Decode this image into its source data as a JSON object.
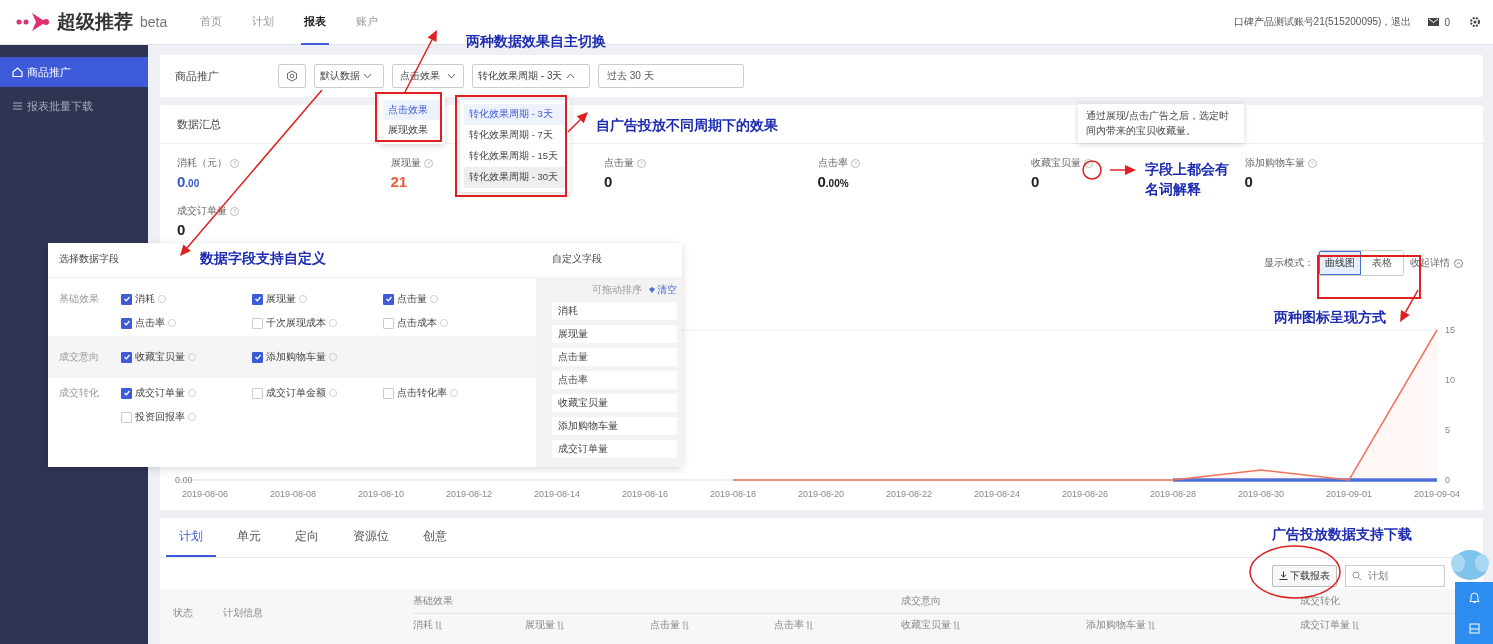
{
  "topbar": {
    "brand": "超级推荐",
    "badge": "beta",
    "nav": [
      {
        "label": "首页",
        "selected": false
      },
      {
        "label": "计划",
        "selected": false
      },
      {
        "label": "报表",
        "selected": true
      },
      {
        "label": "账户",
        "selected": false
      }
    ],
    "account": "口碑产品测试账号21(515200095)，退出",
    "messages": "0"
  },
  "sidebar": {
    "items": [
      {
        "label": "商品推广",
        "selected": true
      },
      {
        "label": "报表批量下载",
        "selected": false
      }
    ]
  },
  "filter_bar": {
    "title": "商品推广",
    "selects": [
      {
        "value": "默认数据",
        "expanded": false
      },
      {
        "value": "点击效果",
        "expanded": false
      },
      {
        "value": "转化效果周期 - 3天",
        "expanded": true
      }
    ],
    "date_range": "过去 30 天",
    "effect_menu": [
      {
        "label": "点击效果",
        "selected": true
      },
      {
        "label": "展现效果",
        "selected": false
      }
    ],
    "period_menu": [
      {
        "label": "转化效果周期 - 3天",
        "selected": true,
        "hovered": false
      },
      {
        "label": "转化效果周期 - 7天",
        "selected": false,
        "hovered": false
      },
      {
        "label": "转化效果周期 - 15天",
        "selected": false,
        "hovered": false
      },
      {
        "label": "转化效果周期 - 30天",
        "selected": false,
        "hovered": true
      }
    ]
  },
  "summary": {
    "title": "数据汇总",
    "metrics": [
      {
        "label": "消耗（元）",
        "value": "0",
        "suffix": ".00",
        "color": "#3557c9"
      },
      {
        "label": "展现量",
        "value": "21",
        "color": "#ee5a3a"
      },
      {
        "label": "点击量",
        "value": "0",
        "color": "#222222"
      },
      {
        "label": "点击率",
        "value": "0",
        "suffix": ".00%",
        "color": "#222222"
      },
      {
        "label": "收藏宝贝量",
        "value": "0",
        "color": "#222222"
      },
      {
        "label": "添加购物车量",
        "value": "0",
        "color": "#222222"
      },
      {
        "label": "成交订单量",
        "value": "0",
        "color": "#222222"
      }
    ],
    "tooltip": "通过展现/点击广告之后，选定时间内带来的宝贝收藏量。"
  },
  "chart": {
    "mode_label": "显示模式：",
    "modes": [
      {
        "label": "曲线图",
        "selected": true
      },
      {
        "label": "表格",
        "selected": false
      }
    ],
    "collapse": "收起详情",
    "left_tick": "0.00",
    "chart_data": {
      "type": "line",
      "categories": [
        "2019-08-06",
        "2019-08-08",
        "2019-08-10",
        "2019-08-12",
        "2019-08-14",
        "2019-08-16",
        "2019-08-18",
        "2019-08-20",
        "2019-08-22",
        "2019-08-24",
        "2019-08-26",
        "2019-08-28",
        "2019-08-30",
        "2019-09-01",
        "2019-09-04"
      ],
      "ylim": [
        0,
        15
      ],
      "yticks": [
        0,
        5,
        10,
        15
      ],
      "series": [
        {
          "color": "#f0735f",
          "values": [
            null,
            null,
            null,
            null,
            null,
            null,
            0,
            0,
            0,
            0,
            0,
            0,
            1,
            0,
            15
          ]
        },
        {
          "color": "#4a6fd8",
          "values": [
            null,
            null,
            null,
            null,
            null,
            null,
            null,
            null,
            null,
            null,
            null,
            0,
            0,
            0,
            0
          ]
        }
      ]
    }
  },
  "field_picker": {
    "title": "选择数据字段",
    "groups": [
      {
        "label": "基础效果",
        "fields": [
          {
            "label": "消耗",
            "checked": true
          },
          {
            "label": "展现量",
            "checked": true
          },
          {
            "label": "点击量",
            "checked": true
          },
          {
            "label": "点击率",
            "checked": true
          },
          {
            "label": "千次展现成本",
            "checked": false
          },
          {
            "label": "点击成本",
            "checked": false
          }
        ]
      },
      {
        "label": "成交意向",
        "fields": [
          {
            "label": "收藏宝贝量",
            "checked": true
          },
          {
            "label": "添加购物车量",
            "checked": true
          }
        ]
      },
      {
        "label": "成交转化",
        "fields": [
          {
            "label": "成交订单量",
            "checked": true
          },
          {
            "label": "成交订单金额",
            "checked": false
          },
          {
            "label": "点击转化率",
            "checked": false
          },
          {
            "label": "投资回报率",
            "checked": false
          }
        ]
      }
    ],
    "custom": {
      "title": "自定义字段",
      "hint": "可拖动排序",
      "clear": "清空",
      "items": [
        "消耗",
        "展现量",
        "点击量",
        "点击率",
        "收藏宝贝量",
        "添加购物车量",
        "成交订单量"
      ]
    }
  },
  "detail": {
    "tabs": [
      {
        "label": "计划",
        "selected": true
      },
      {
        "label": "单元",
        "selected": false
      },
      {
        "label": "定向",
        "selected": false
      },
      {
        "label": "资源位",
        "selected": false
      },
      {
        "label": "创意",
        "selected": false
      }
    ],
    "download": "下载报表",
    "search_placeholder": "计划",
    "columns": [
      "状态",
      "计划信息"
    ],
    "groups": [
      {
        "label": "基础效果",
        "columns": [
          "消耗",
          "展现量",
          "点击量",
          "点击率"
        ]
      },
      {
        "label": "成交意向",
        "columns": [
          "收藏宝贝量",
          "添加购物车量"
        ]
      },
      {
        "label": "成交转化",
        "columns": [
          "成交订单量"
        ]
      }
    ]
  },
  "annotations": [
    "两种数据效果自主切换",
    "自广告投放不同周期下的效果",
    "字段上都会有名词解释",
    "数据字段支持自定义",
    "两种图标呈现方式",
    "广告投放数据支持下载"
  ]
}
